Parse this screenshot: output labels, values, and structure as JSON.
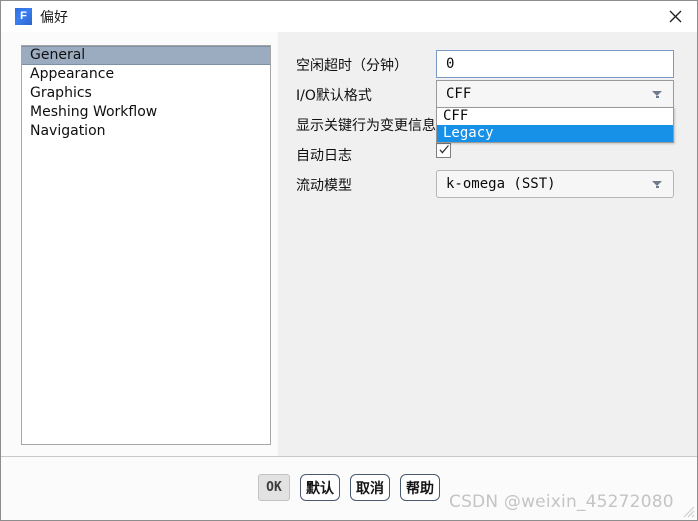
{
  "window": {
    "title": "偏好",
    "app_icon_letter": "F",
    "close_icon": "close-icon"
  },
  "sidebar": {
    "items": [
      {
        "label": "General",
        "selected": true
      },
      {
        "label": "Appearance",
        "selected": false
      },
      {
        "label": "Graphics",
        "selected": false
      },
      {
        "label": "Meshing Workflow",
        "selected": false
      },
      {
        "label": "Navigation",
        "selected": false
      }
    ]
  },
  "form": {
    "rows": [
      {
        "label": "空闲超时（分钟）",
        "type": "text",
        "value": "0",
        "placeholder": ""
      },
      {
        "label": "I/O默认格式",
        "type": "combo-open",
        "value": "CFF",
        "options": [
          {
            "label": "CFF",
            "highlighted": false
          },
          {
            "label": "Legacy",
            "highlighted": true
          }
        ]
      },
      {
        "label": "显示关键行为变更信息",
        "type": "hidden-by-dropdown",
        "value": ""
      },
      {
        "label": "自动日志",
        "type": "checkbox",
        "checked": true
      },
      {
        "label": "流动模型",
        "type": "combo",
        "value": "k-omega (SST)"
      }
    ]
  },
  "footer": {
    "buttons": [
      {
        "label": "OK",
        "style": "default-focus"
      },
      {
        "label": "默认",
        "style": "normal"
      },
      {
        "label": "取消",
        "style": "normal"
      },
      {
        "label": "帮助",
        "style": "normal"
      }
    ]
  },
  "watermark": {
    "text": "CSDN @weixin_45272080"
  },
  "colors": {
    "selection_blue": "#1790e8",
    "sidebar_selected": "#9bacc1",
    "panel_bg": "#f0f0f0",
    "accent_icon": "#3b7ef0"
  }
}
